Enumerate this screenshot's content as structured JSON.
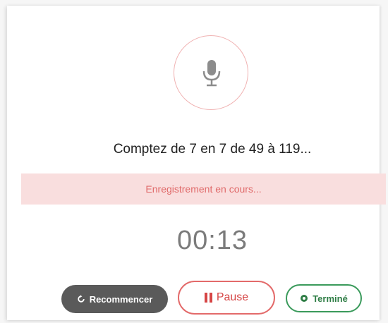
{
  "prompt": {
    "text": "Comptez de 7 en 7 de 49 à 119..."
  },
  "status": {
    "text": "Enregistrement en cours..."
  },
  "timer": {
    "value": "00:13"
  },
  "buttons": {
    "restart_label": "Recommencer",
    "pause_label": "Pause",
    "done_label": "Terminé"
  },
  "icons": {
    "mic": "microphone-icon",
    "restart": "restart-icon",
    "pause": "pause-icon",
    "done": "record-dot-icon"
  },
  "colors": {
    "accent_red": "#e36a6a",
    "banner_bg": "#f9dede",
    "done_green": "#3a9a5b",
    "restart_gray": "#5a5a5a",
    "timer_gray": "#7b7b7b"
  }
}
